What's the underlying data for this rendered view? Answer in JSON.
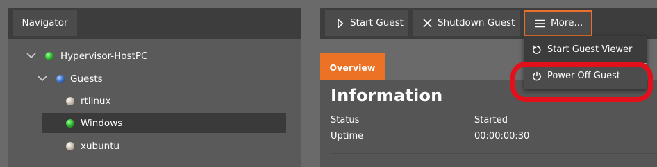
{
  "navigator": {
    "tab_label": "Navigator",
    "tree": [
      {
        "label": "Hypervisor-HostPC",
        "status": "green",
        "expanded": true,
        "level": 0
      },
      {
        "label": "Guests",
        "status": "blue",
        "expanded": true,
        "level": 1
      },
      {
        "label": "rtlinux",
        "status": "gray",
        "level": 2
      },
      {
        "label": "Windows",
        "status": "green",
        "level": 2,
        "selected": true
      },
      {
        "label": "xubuntu",
        "status": "gray",
        "level": 2
      }
    ]
  },
  "toolbar": {
    "start_label": "Start Guest",
    "shutdown_label": "Shutdown Guest",
    "more_label": "More..."
  },
  "more_menu": {
    "items": [
      {
        "label": "Start Guest Viewer",
        "icon": "refresh-icon"
      },
      {
        "label": "Power Off Guest",
        "icon": "power-icon"
      }
    ]
  },
  "tabs": {
    "overview_label": "Overview"
  },
  "information": {
    "title": "Information",
    "rows": [
      {
        "key": "Status",
        "value": "Started"
      },
      {
        "key": "Uptime",
        "value": "00:00:00:30"
      }
    ]
  },
  "colors": {
    "accent": "#ec7226",
    "highlight_ring": "#e3101b",
    "status_green": "#3fcf3f",
    "status_blue": "#4a80d8",
    "status_gray": "#cfc7b8"
  }
}
